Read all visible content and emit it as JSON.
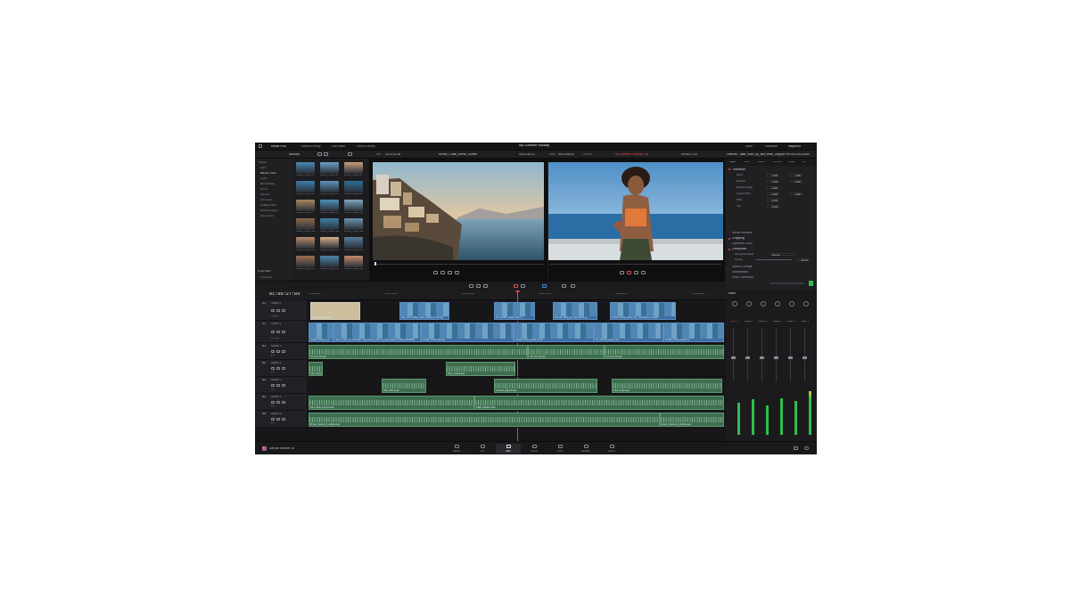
{
  "menubar": {
    "tabs": [
      "Media Pool",
      "Effects Library",
      "Edit Index",
      "Sound Library"
    ],
    "project_title": "My Summer Holiday",
    "right_tabs": [
      "Mixer",
      "Metadata",
      "Inspector"
    ]
  },
  "toolbar": {
    "bin_name": "Balcony",
    "source_zoom": "0%",
    "source_timecode": "00:11:11:08",
    "source_clip": "Amalfi_Coast_Aerial_Sunset",
    "source_duration": "00:11:30:12",
    "program_zoom": "50%",
    "program_timecode_left": "00:11:58:15",
    "program_fps": "23.976",
    "timeline_name": "My Summer Holiday Edit",
    "program_timecode": "00:00:27:03",
    "inspector_file": "Timeline - date_lined_by_sea_back_Afigma PRORES422.mov"
  },
  "bins": {
    "items": [
      "Master",
      "Alms",
      "Balcony View",
      "Audio",
      "Bird Studies",
      "Drone",
      "Airports",
      "Interviews",
      "Holiday Shell",
      "Stock Footage",
      "Sony Stock"
    ],
    "smart_bins_label": "Smart Bins",
    "smart_items": [
      "Timelines",
      "Keywords"
    ]
  },
  "media": {
    "thumbs": [
      {
        "label": "Amalfi_Coast_S1",
        "color": "#4a88b5"
      },
      {
        "label": "Amalfi_Coast_S2",
        "color": "#6aa0c8"
      },
      {
        "label": "Amalfi_Coast_S3",
        "color": "#c7a07a"
      },
      {
        "label": "Amalfi_Coast_S4",
        "color": "#3f7da8"
      },
      {
        "label": "Amalfi_Coast_S5",
        "color": "#5c93bb"
      },
      {
        "label": "Amalfi_Coast_S6",
        "color": "#2f6f96"
      },
      {
        "label": "Amalfi_Coast_S7",
        "color": "#a8885f"
      },
      {
        "label": "Amalfi_Coast_S8",
        "color": "#4f8fb8"
      },
      {
        "label": "Amalfi_Coast_S9",
        "color": "#7fa6c0"
      },
      {
        "label": "Amalfi_Coast_S10",
        "color": "#8a6a4e"
      },
      {
        "label": "Amalfi_Coast_S11",
        "color": "#3d7ea6"
      },
      {
        "label": "Amalfi_Coast_S12",
        "color": "#6992ae"
      },
      {
        "label": "Amalfi_Coast_S13",
        "color": "#b88b6a"
      },
      {
        "label": "Amalfi_Coast_S14",
        "color": "#d4b08a"
      },
      {
        "label": "Amalfi_Coast_S15",
        "color": "#557d99"
      },
      {
        "label": "Amalfi_Coast_S16",
        "color": "#9b6f52"
      },
      {
        "label": "Amalfi_Coast_S17",
        "color": "#4a86ad"
      },
      {
        "label": "Amalfi_Coast_S18",
        "color": "#c48a6b"
      }
    ]
  },
  "inspector": {
    "tabs": [
      "Video",
      "Audio",
      "Effects",
      "Transition",
      "Image",
      "File"
    ],
    "transform_label": "Transform",
    "rows": [
      {
        "label": "Zoom",
        "x": "1.000",
        "y": "1.000"
      },
      {
        "label": "Position",
        "x": "0.000",
        "y": "0.000"
      },
      {
        "label": "Rotation Angle",
        "x": "0.000",
        "y": ""
      },
      {
        "label": "Anchor Point",
        "x": "0.000",
        "y": "0.000"
      },
      {
        "label": "Pitch",
        "x": "0.000",
        "y": ""
      },
      {
        "label": "Yaw",
        "x": "0.000",
        "y": ""
      }
    ],
    "sections": [
      "Smart Reframe",
      "Cropping",
      "Dynamic Zoom",
      "Composite",
      "Speed Change",
      "Stabilization",
      "Lens Correction"
    ],
    "composite_mode_label": "Composite Mode",
    "composite_mode_value": "Normal",
    "opacity_label": "Opacity",
    "opacity_value": "100.00"
  },
  "timeline": {
    "timecode": "01:00:27:03",
    "ruler": [
      "01:00:00:00",
      "01:00:08:00",
      "01:00:16:00",
      "01:00:24:00",
      "01:00:32:00",
      "01:00:40:00"
    ],
    "tracks": [
      {
        "id": "V2",
        "name": "Video 2",
        "info": "4 Clips"
      },
      {
        "id": "V1",
        "name": "Video 1",
        "info": "22 Clips"
      },
      {
        "id": "A1",
        "name": "Audio 1",
        "info": "2.0"
      },
      {
        "id": "A2",
        "name": "Audio 2",
        "info": "2.0"
      },
      {
        "id": "A3",
        "name": "Audio 3",
        "info": "2.0"
      },
      {
        "id": "A4",
        "name": "Audio 4",
        "info": "2.0"
      },
      {
        "id": "A5",
        "name": "Audio 5",
        "info": "2.0"
      }
    ],
    "v2_clips": [
      "Color Filter Cream",
      "sea_view_sitting_sand_aerial_hz_sunset",
      "V1_Amalfi_Coast_boat_d",
      "bicycle_riding_on_the_beach_b",
      "Amalfi_Aerial_sitting_the_mountains_sunlight"
    ],
    "v1_clips": [
      "Amalfi_Coast_S_3",
      "drone_view_of_mountain_and_house_town_by_the_beach_Amalfi_PRORES",
      "Amalfi_Coast_Sunset",
      "Amalfi_Coast_Aerial_B_01",
      "V1_Clouds_coast_sea",
      "Amalfi_Coast_Aerial_S"
    ],
    "audio_clips": {
      "a1": [
        "VO_01_01.wav",
        "VO_01_02.wav",
        "VO_01_03.wav"
      ],
      "a2": [
        "SFX_Waves.wav",
        "SFX_Crowd.wav"
      ],
      "a3": [
        "SFX_Wind.wav",
        "Ambient_Beach.wav",
        "SFX_Gulls.wav"
      ],
      "a4": [
        "SFX_Boat_Engine.wav",
        "AMB_Harbour.wav"
      ],
      "a5": [
        "Music_Summer_Holiday.wav",
        "Music_Summer_Holiday.wav"
      ]
    }
  },
  "mixer": {
    "title": "Mixer",
    "channels": [
      "Audio 1",
      "Audio 2",
      "Audio 3",
      "Audio 4",
      "Audio 5",
      "Main 1"
    ],
    "levels": [
      0.55,
      0.6,
      0.5,
      0.62,
      0.58,
      0.75
    ]
  },
  "bottom": {
    "product": "DaVinci Resolve 18",
    "pages": [
      "Media",
      "Cut",
      "Edit",
      "Fusion",
      "Color",
      "Fairlight",
      "Deliver"
    ],
    "active_page": "Edit"
  },
  "colors": {
    "accent": "#e04a3f",
    "video_clip": "#3d6ea3",
    "audio_clip": "#3e6e4f",
    "meter": "#2fbf4a"
  }
}
